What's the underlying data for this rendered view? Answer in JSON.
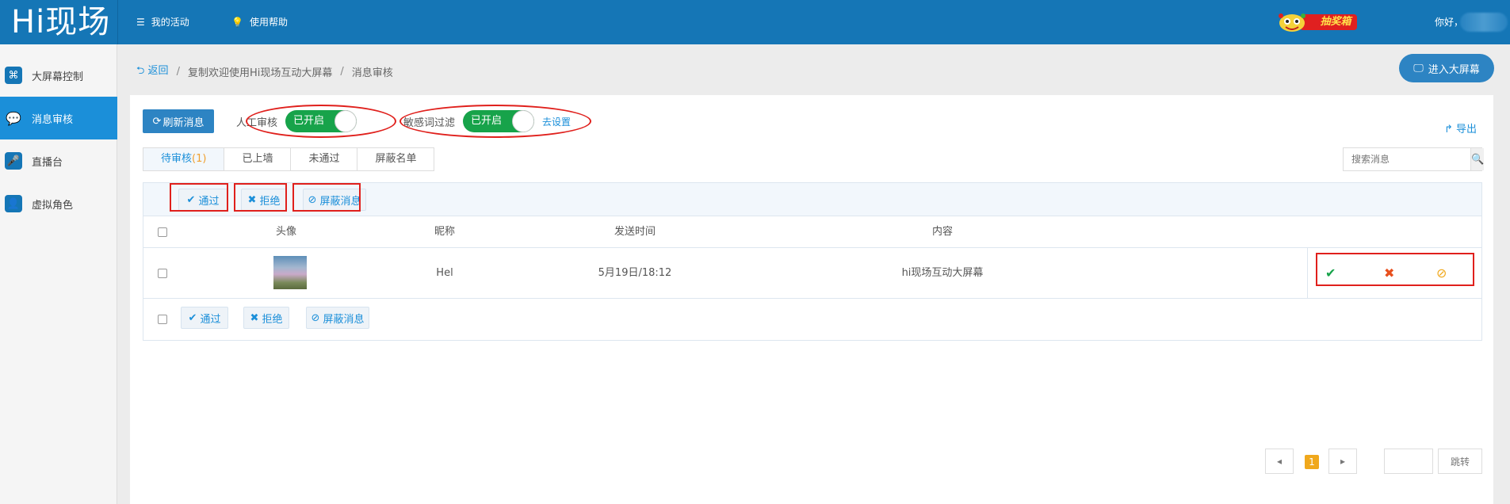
{
  "topbar": {
    "logo": "Hi现场",
    "nav": [
      {
        "label": "我的活动",
        "icon": "list-icon"
      },
      {
        "label": "使用帮助",
        "icon": "lightbulb-icon"
      }
    ],
    "lottery_label": "抽奖箱",
    "greeting": "你好，"
  },
  "sidebar": {
    "items": [
      {
        "label": "大屏幕控制",
        "icon": "command-icon"
      },
      {
        "label": "消息审核",
        "icon": "chat-bubble-icon",
        "active": true
      },
      {
        "label": "直播台",
        "icon": "microphone-icon"
      },
      {
        "label": "虚拟角色",
        "icon": "person-icon"
      }
    ]
  },
  "breadcrumb": {
    "back": "返回",
    "items": [
      "复制欢迎使用Hi现场互动大屏幕",
      "消息审核"
    ]
  },
  "enter_screen_label": "进入大屏幕",
  "controls": {
    "refresh_label": "刷新消息",
    "manual_review_label": "人工审核",
    "manual_review_state": "已开启",
    "sensitive_filter_label": "敏感词过滤",
    "sensitive_filter_state": "已开启",
    "goto_settings": "去设置",
    "export_label": "导出"
  },
  "tabs": [
    {
      "label": "待审核",
      "count": "(1)",
      "active": true
    },
    {
      "label": "已上墙"
    },
    {
      "label": "未通过"
    },
    {
      "label": "屏蔽名单"
    }
  ],
  "search": {
    "placeholder": "搜索消息"
  },
  "actions": {
    "approve": "通过",
    "reject": "拒绝",
    "block": "屏蔽消息"
  },
  "table": {
    "columns": [
      "头像",
      "昵称",
      "发送时间",
      "内容"
    ],
    "rows": [
      {
        "nickname": "Hel",
        "time": "5月19日/18:12",
        "content": "hi现场互动大屏幕"
      }
    ]
  },
  "pagination": {
    "current": "1",
    "jump_label": "跳转"
  },
  "colors": {
    "topbar": "#1576b6",
    "active": "#1b8fd9",
    "approve": "#17a34a",
    "reject": "#e8501e",
    "block": "#f0a81c"
  }
}
